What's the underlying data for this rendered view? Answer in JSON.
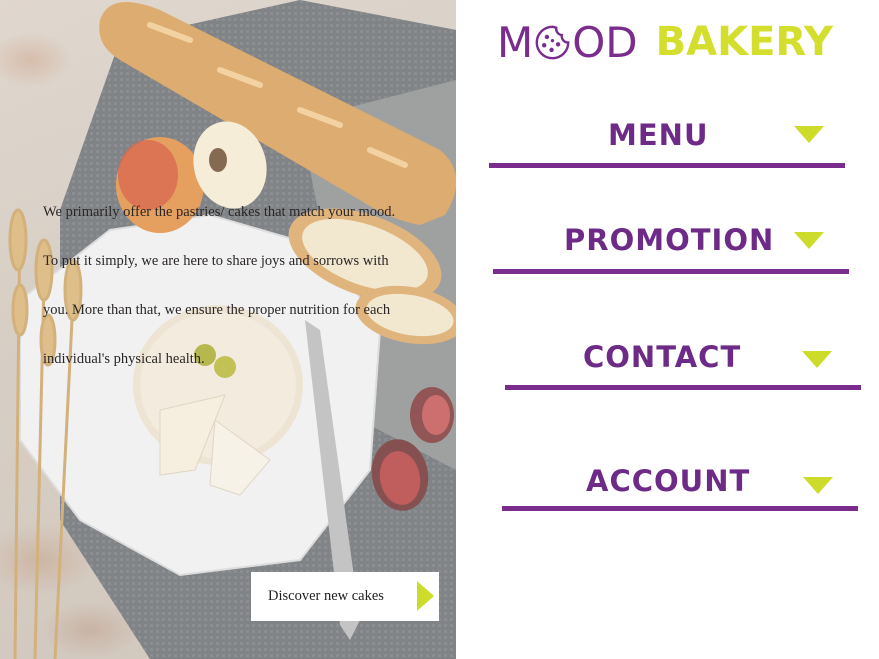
{
  "brand": {
    "mood": "MOOD",
    "mood_m": "M",
    "mood_od": "OD",
    "bakery": "BAKERY",
    "color_purple": "#7b2d8e",
    "color_lime": "#d4de2d"
  },
  "hero": {
    "text": "We primarily offer the pastries/ cakes that match your mood. To put it simply, we are here to share joys and sorrows with you. More than that, we ensure the proper nutrition for each individual's physical health.",
    "button_label": "Discover new cakes"
  },
  "nav": [
    {
      "label": "MENU",
      "icon": "triangle-down-icon"
    },
    {
      "label": "PROMOTION",
      "icon": "triangle-down-icon"
    },
    {
      "label": "CONTACT",
      "icon": "triangle-down-icon"
    },
    {
      "label": "ACCOUNT",
      "icon": "triangle-down-icon"
    }
  ]
}
